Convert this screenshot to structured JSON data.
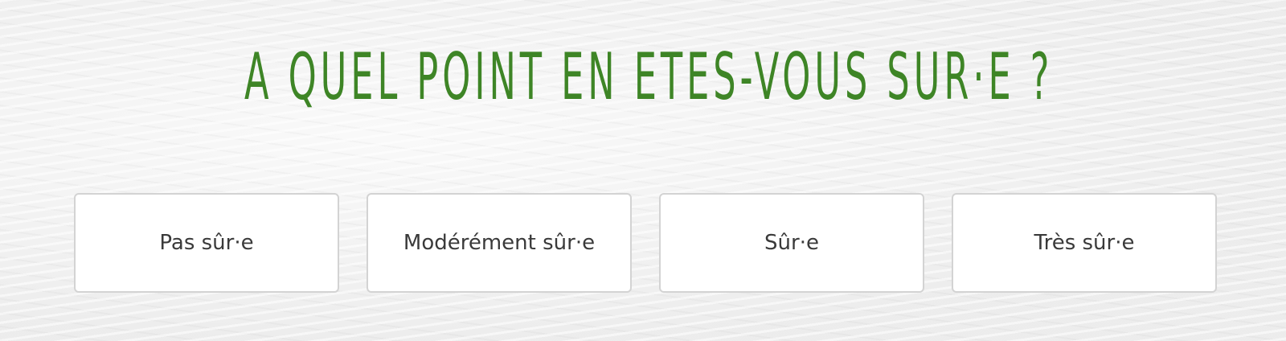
{
  "question": {
    "title": "A quel point en etes-vous sur·e ?",
    "color": "#3e8526"
  },
  "options": [
    {
      "label": "Pas sûr·e"
    },
    {
      "label": "Modérément sûr·e"
    },
    {
      "label": "Sûr·e"
    },
    {
      "label": "Très sûr·e"
    }
  ]
}
